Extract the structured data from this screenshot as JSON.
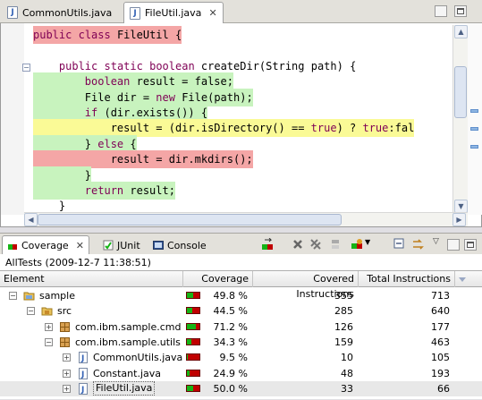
{
  "editor": {
    "tabs": [
      {
        "label": "CommonUtils.java",
        "active": false
      },
      {
        "label": "FileUtil.java",
        "active": true
      }
    ],
    "lines": [
      {
        "text": "public class FileUtil {",
        "hl": "red"
      },
      {
        "text": "",
        "hl": "none"
      },
      {
        "text": "    public static boolean createDir(String path) {",
        "hl": "none"
      },
      {
        "text": "        boolean result = false;",
        "hl": "green"
      },
      {
        "text": "        File dir = new File(path);",
        "hl": "green"
      },
      {
        "text": "        if (dir.exists()) {",
        "hl": "green"
      },
      {
        "text": "            result = (dir.isDirectory() == true) ? true:fal",
        "hl": "yellow"
      },
      {
        "text": "        } else {",
        "hl": "green"
      },
      {
        "text": "            result = dir.mkdirs();",
        "hl": "red"
      },
      {
        "text": "        }",
        "hl": "green"
      },
      {
        "text": "        return result;",
        "hl": "green"
      },
      {
        "text": "    }",
        "hl": "none"
      }
    ]
  },
  "views": {
    "tabs": [
      {
        "label": "Coverage",
        "active": true,
        "icon": "coverage-icon"
      },
      {
        "label": "JUnit",
        "active": false,
        "icon": "junit-icon"
      },
      {
        "label": "Console",
        "active": false,
        "icon": "console-icon"
      }
    ],
    "toolbar_icons": [
      "relaunch-icon",
      "remove-session-icon",
      "remove-all-sessions-icon",
      "merge-sessions-icon",
      "select-session-icon",
      "collapse-all-icon",
      "link-editor-icon",
      "view-menu-icon"
    ],
    "session_label": "AllTests (2009-12-7 11:38:51)"
  },
  "coverage": {
    "headers": {
      "element": "Element",
      "coverage": "Coverage",
      "covered": "Covered Instructions",
      "total": "Total Instructions"
    },
    "rows": [
      {
        "name": "sample",
        "icon": "project-icon",
        "level": 0,
        "expander": "−",
        "coverage": "49.8 %",
        "ratio": 0.498,
        "covered": "355",
        "total": "713"
      },
      {
        "name": "src",
        "icon": "source-folder-icon",
        "level": 1,
        "expander": "−",
        "coverage": "44.5 %",
        "ratio": 0.445,
        "covered": "285",
        "total": "640"
      },
      {
        "name": "com.ibm.sample.cmd",
        "icon": "package-icon",
        "level": 2,
        "expander": "+",
        "coverage": "71.2 %",
        "ratio": 0.712,
        "covered": "126",
        "total": "177"
      },
      {
        "name": "com.ibm.sample.utils",
        "icon": "package-icon",
        "level": 2,
        "expander": "−",
        "coverage": "34.3 %",
        "ratio": 0.343,
        "covered": "159",
        "total": "463"
      },
      {
        "name": "CommonUtils.java",
        "icon": "java-file-icon",
        "level": 3,
        "expander": "+",
        "coverage": "9.5 %",
        "ratio": 0.095,
        "covered": "10",
        "total": "105"
      },
      {
        "name": "Constant.java",
        "icon": "java-file-icon",
        "level": 3,
        "expander": "+",
        "coverage": "24.9 %",
        "ratio": 0.249,
        "covered": "48",
        "total": "193"
      },
      {
        "name": "FileUtil.java",
        "icon": "java-file-icon",
        "level": 3,
        "expander": "+",
        "coverage": "50.0 %",
        "ratio": 0.5,
        "covered": "33",
        "total": "66",
        "selected": true
      }
    ]
  },
  "colors": {
    "covered": "#16b416",
    "missed": "#c00000",
    "partial": "#fafa96",
    "keyword": "#7f0055"
  }
}
